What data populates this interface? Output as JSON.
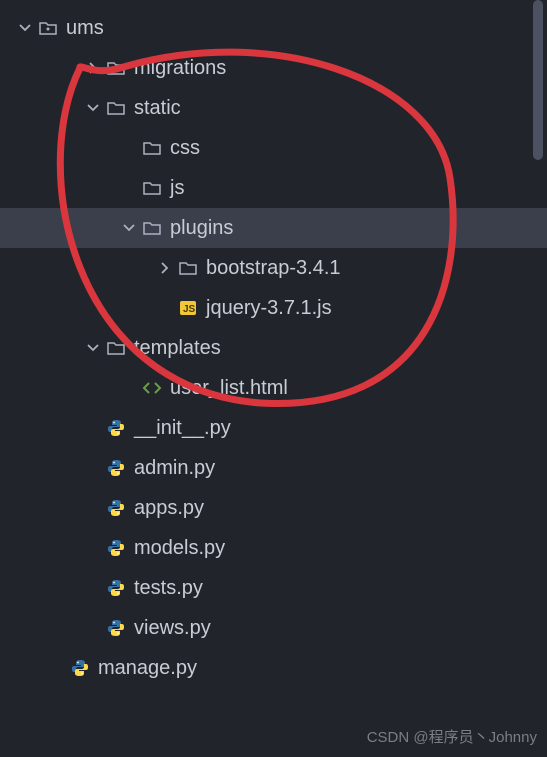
{
  "tree": {
    "root": {
      "label": "ums",
      "type": "folder-open",
      "expanded": true,
      "depth": 0
    },
    "items": [
      {
        "label": "migrations",
        "type": "folder-dot",
        "expanded": false,
        "chevron": "right",
        "depth": 1
      },
      {
        "label": "static",
        "type": "folder",
        "expanded": true,
        "chevron": "down",
        "depth": 1
      },
      {
        "label": "css",
        "type": "folder",
        "chevron": "none",
        "depth": 2
      },
      {
        "label": "js",
        "type": "folder",
        "chevron": "none",
        "depth": 2
      },
      {
        "label": "plugins",
        "type": "folder",
        "expanded": true,
        "chevron": "down",
        "depth": 2,
        "selected": true
      },
      {
        "label": "bootstrap-3.4.1",
        "type": "folder",
        "chevron": "right",
        "depth": 3
      },
      {
        "label": "jquery-3.7.1.js",
        "type": "js",
        "chevron": "none",
        "depth": 3
      },
      {
        "label": "templates",
        "type": "folder",
        "expanded": true,
        "chevron": "down",
        "depth": 1
      },
      {
        "label": "user_list.html",
        "type": "html",
        "chevron": "none",
        "depth": 2
      },
      {
        "label": "__init__.py",
        "type": "python",
        "chevron": "none",
        "depth": 1
      },
      {
        "label": "admin.py",
        "type": "python",
        "chevron": "none",
        "depth": 1
      },
      {
        "label": "apps.py",
        "type": "python",
        "chevron": "none",
        "depth": 1
      },
      {
        "label": "models.py",
        "type": "python",
        "chevron": "none",
        "depth": 1
      },
      {
        "label": "tests.py",
        "type": "python",
        "chevron": "none",
        "depth": 1
      },
      {
        "label": "views.py",
        "type": "python",
        "chevron": "none",
        "depth": 1
      }
    ],
    "outside": {
      "label": "manage.py",
      "type": "python",
      "depth": 0
    }
  },
  "watermark": "CSDN @程序员丶Johnny"
}
